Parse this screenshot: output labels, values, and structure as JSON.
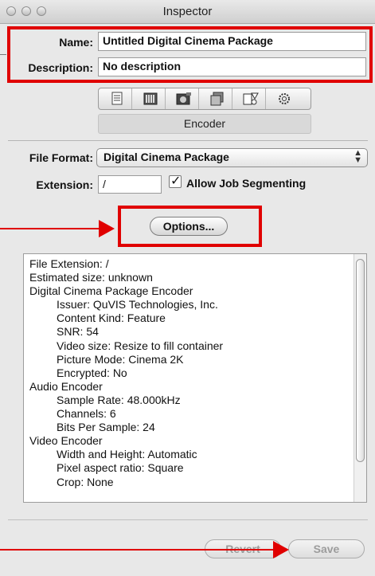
{
  "window": {
    "title": "Inspector"
  },
  "fields": {
    "name_label": "Name:",
    "name_value": "Untitled Digital Cinema Package",
    "description_label": "Description:",
    "description_value": "No description"
  },
  "tabs": {
    "icons": [
      "general-tab-icon",
      "filter-tab-icon",
      "encoder-tab-icon",
      "geometry-tab-icon",
      "actions-tab-icon",
      "settings-tab-icon"
    ],
    "active_label": "Encoder"
  },
  "encoder": {
    "file_format_label": "File Format:",
    "file_format_value": "Digital Cinema Package",
    "extension_label": "Extension:",
    "extension_value": "/",
    "allow_segmenting_label": "Allow Job Segmenting",
    "allow_segmenting_checked": true,
    "options_button": "Options..."
  },
  "summary_lines": [
    {
      "text": "File Extension: /",
      "indent": 0
    },
    {
      "text": "Estimated size: unknown",
      "indent": 0
    },
    {
      "text": "Digital Cinema Package Encoder",
      "indent": 0
    },
    {
      "text": "Issuer: QuVIS Technologies, Inc.",
      "indent": 1
    },
    {
      "text": "Content Kind: Feature",
      "indent": 1
    },
    {
      "text": "SNR: 54",
      "indent": 1
    },
    {
      "text": "Video size: Resize to fill container",
      "indent": 1
    },
    {
      "text": "Picture Mode: Cinema 2K",
      "indent": 1
    },
    {
      "text": "Encrypted: No",
      "indent": 1
    },
    {
      "text": "Audio Encoder",
      "indent": 0
    },
    {
      "text": "Sample Rate: 48.000kHz",
      "indent": 1
    },
    {
      "text": "Channels: 6",
      "indent": 1
    },
    {
      "text": "Bits Per Sample: 24",
      "indent": 1
    },
    {
      "text": "Video Encoder",
      "indent": 0
    },
    {
      "text": "Width and Height: Automatic",
      "indent": 1
    },
    {
      "text": "Pixel aspect ratio: Square",
      "indent": 1
    },
    {
      "text": "Crop: None",
      "indent": 1
    }
  ],
  "footer": {
    "revert_button": "Revert",
    "save_button": "Save"
  },
  "colors": {
    "highlight": "#e00000",
    "window_bg": "#e8e8e8"
  }
}
